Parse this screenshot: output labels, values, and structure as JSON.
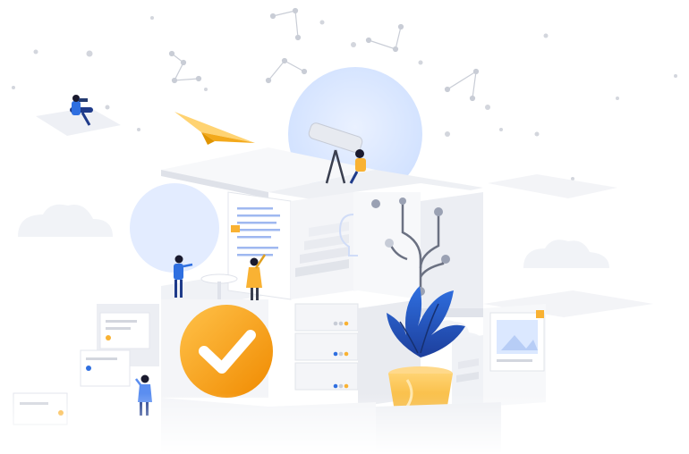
{
  "illustration": {
    "colors": {
      "primary_blue": "#2f6fe0",
      "dark_blue": "#1f3b8a",
      "accent_yellow": "#f9b233",
      "orange": "#f39c12",
      "light_blue": "#dbe8ff",
      "cube_face_light": "#f4f5f8",
      "cube_face_mid": "#e6e8ee",
      "cube_face_dark": "#d4d8e1",
      "dots": "#c9ccd4"
    },
    "elements": [
      "constellation-lines",
      "paper-plane-icon",
      "telescope-icon",
      "checkmark-icon",
      "potted-plant",
      "server-rack",
      "document-page",
      "image-card",
      "person-figures",
      "clouds"
    ]
  }
}
